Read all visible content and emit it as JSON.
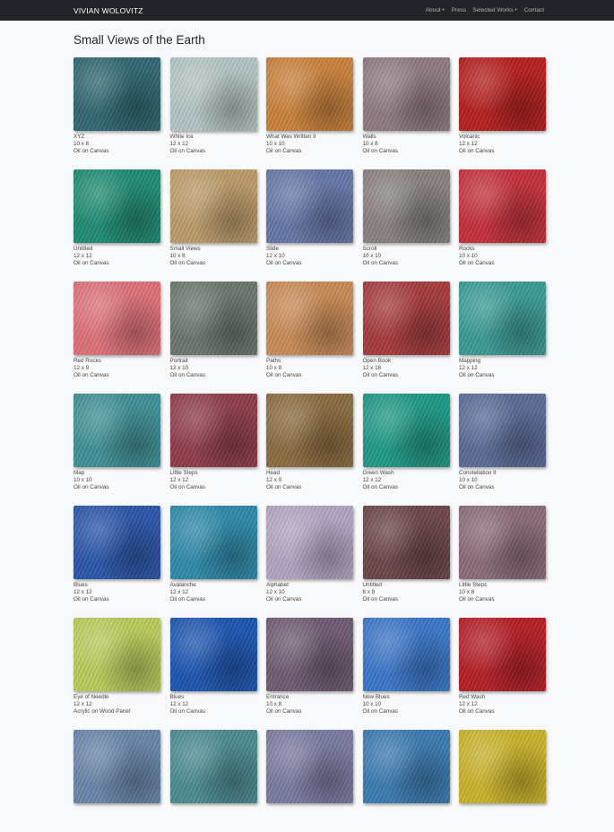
{
  "nav": {
    "brand": "VIVIAN WOLOVITZ",
    "links": [
      "About",
      "Press",
      "Selected Works",
      "Contact"
    ]
  },
  "page": {
    "title": "Small Views of the Earth"
  },
  "works": [
    {
      "title": "XYZ",
      "size": "10 x 8",
      "medium": "Oil on Canvas",
      "color": "#2f6670"
    },
    {
      "title": "White Ice",
      "size": "12 x 12",
      "medium": "Oil on Canvas",
      "color": "#b3c3c4"
    },
    {
      "title": "What Was Written II",
      "size": "10 x 10",
      "medium": "Oil on Canvas",
      "color": "#c8803b"
    },
    {
      "title": "Walls",
      "size": "10 x 8",
      "medium": "Oil on Canvas",
      "color": "#8e7a80"
    },
    {
      "title": "Volcanic",
      "size": "12 x 12",
      "medium": "Oil on Canvas",
      "color": "#b51e1e"
    },
    {
      "title": "Untitled",
      "size": "12 x 12",
      "medium": "Oil on Canvas",
      "color": "#1e8b72"
    },
    {
      "title": "Small Views",
      "size": "10 x 8",
      "medium": "Oil on Canvas",
      "color": "#bb9a68"
    },
    {
      "title": "Slide",
      "size": "12 x 10",
      "medium": "Oil on Canvas",
      "color": "#6575a6"
    },
    {
      "title": "Scroll",
      "size": "10 x 10",
      "medium": "Oil on Canvas",
      "color": "#87807e"
    },
    {
      "title": "Rocks",
      "size": "10 x 10",
      "medium": "Oil on Canvas",
      "color": "#c32f3a"
    },
    {
      "title": "Red Rocks",
      "size": "12 x 9",
      "medium": "Oil on Canvas",
      "color": "#dd7078"
    },
    {
      "title": "Portrait",
      "size": "12 x 10",
      "medium": "Oil on Canvas",
      "color": "#6a756d"
    },
    {
      "title": "Paths",
      "size": "10 x 8",
      "medium": "Oil on Canvas",
      "color": "#c88a55"
    },
    {
      "title": "Open Book",
      "size": "12 x 16",
      "medium": "Oil on Canvas",
      "color": "#a53a3c"
    },
    {
      "title": "Mapping",
      "size": "12 x 12",
      "medium": "Oil on Canvas",
      "color": "#3a9a94"
    },
    {
      "title": "Map",
      "size": "10 x 10",
      "medium": "Oil on Canvas",
      "color": "#3e8f95"
    },
    {
      "title": "Little Steps",
      "size": "12 x 12",
      "medium": "Oil on Canvas",
      "color": "#8e3c49"
    },
    {
      "title": "Head",
      "size": "12 x 9",
      "medium": "Oil on Canvas",
      "color": "#8a6b3f"
    },
    {
      "title": "Green Wash",
      "size": "12 x 12",
      "medium": "Oil on Canvas",
      "color": "#1e9884"
    },
    {
      "title": "Constellation II",
      "size": "10 x 10",
      "medium": "Oil on Canvas",
      "color": "#5a6a96"
    },
    {
      "title": "Blues",
      "size": "12 x 12",
      "medium": "Oil on Canvas",
      "color": "#2a55a8"
    },
    {
      "title": "Avalanche",
      "size": "12 x 12",
      "medium": "Oil on Canvas",
      "color": "#2d89a8"
    },
    {
      "title": "Alphabet",
      "size": "12 x 10",
      "medium": "Oil on Canvas",
      "color": "#b2a4c2"
    },
    {
      "title": "Untitled",
      "size": "8 x 8",
      "medium": "Oil on Canvas",
      "color": "#6b4548"
    },
    {
      "title": "Little Steps",
      "size": "10 x 8",
      "medium": "Oil on Canvas",
      "color": "#8a6a78"
    },
    {
      "title": "Eye of Needle",
      "size": "12 x 12",
      "medium": "Acrylic on Wood Panel",
      "color": "#b9c95a"
    },
    {
      "title": "Blues",
      "size": "12 x 12",
      "medium": "Oil on Canvas",
      "color": "#1d55b0"
    },
    {
      "title": "Entrance",
      "size": "10 x 8",
      "medium": "Oil on Canvas",
      "color": "#6f5a72"
    },
    {
      "title": "New Blues",
      "size": "10 x 10",
      "medium": "Oil on Canvas",
      "color": "#3a75c8"
    },
    {
      "title": "Red Wash",
      "size": "12 x 12",
      "medium": "Oil on Canvas",
      "color": "#b41e26"
    },
    {
      "title": "",
      "size": "",
      "medium": "",
      "color": "#6884a8"
    },
    {
      "title": "",
      "size": "",
      "medium": "",
      "color": "#4a8a90"
    },
    {
      "title": "",
      "size": "",
      "medium": "",
      "color": "#7a7aa0"
    },
    {
      "title": "",
      "size": "",
      "medium": "",
      "color": "#3a7ab0"
    },
    {
      "title": "",
      "size": "",
      "medium": "",
      "color": "#c8b22a"
    }
  ]
}
